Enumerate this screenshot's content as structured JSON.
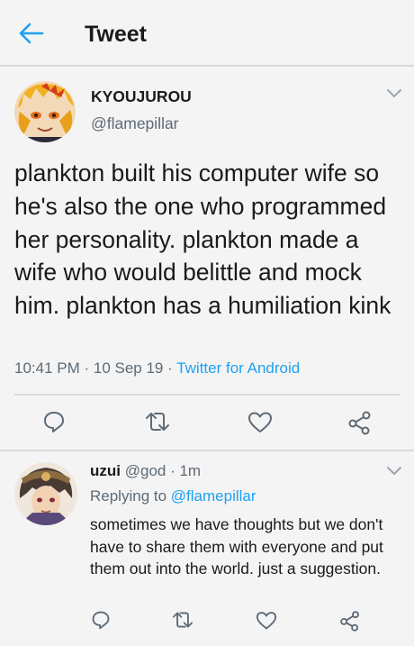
{
  "header": {
    "title": "Tweet",
    "back_icon": "arrow-left-icon"
  },
  "tweet": {
    "display_name": "KYOUJUROU",
    "handle": "@flamepillar",
    "text": "plankton built his computer wife so he's also the one who programmed her personality. plankton made a wife who would belittle and mock him. plankton has a humiliation kink",
    "time": "10:41 PM",
    "sep1": " · ",
    "date": "10 Sep 19",
    "sep2": " · ",
    "client": "Twitter for Android"
  },
  "reply": {
    "display_name": "uzui",
    "handle": "@god",
    "sep": " · ",
    "age": "1m",
    "replying_prefix": "Replying to ",
    "replying_to": "@flamepillar",
    "text": "sometimes we have thoughts but we don't have to share them with everyone and put them out into the world. just a suggestion."
  },
  "colors": {
    "accent": "#1da1f2",
    "muted": "#5d6a76",
    "background": "#f4f4f4"
  },
  "icons": [
    "arrow-left-icon",
    "chevron-down-icon",
    "reply-icon",
    "retweet-icon",
    "like-icon",
    "share-icon"
  ]
}
